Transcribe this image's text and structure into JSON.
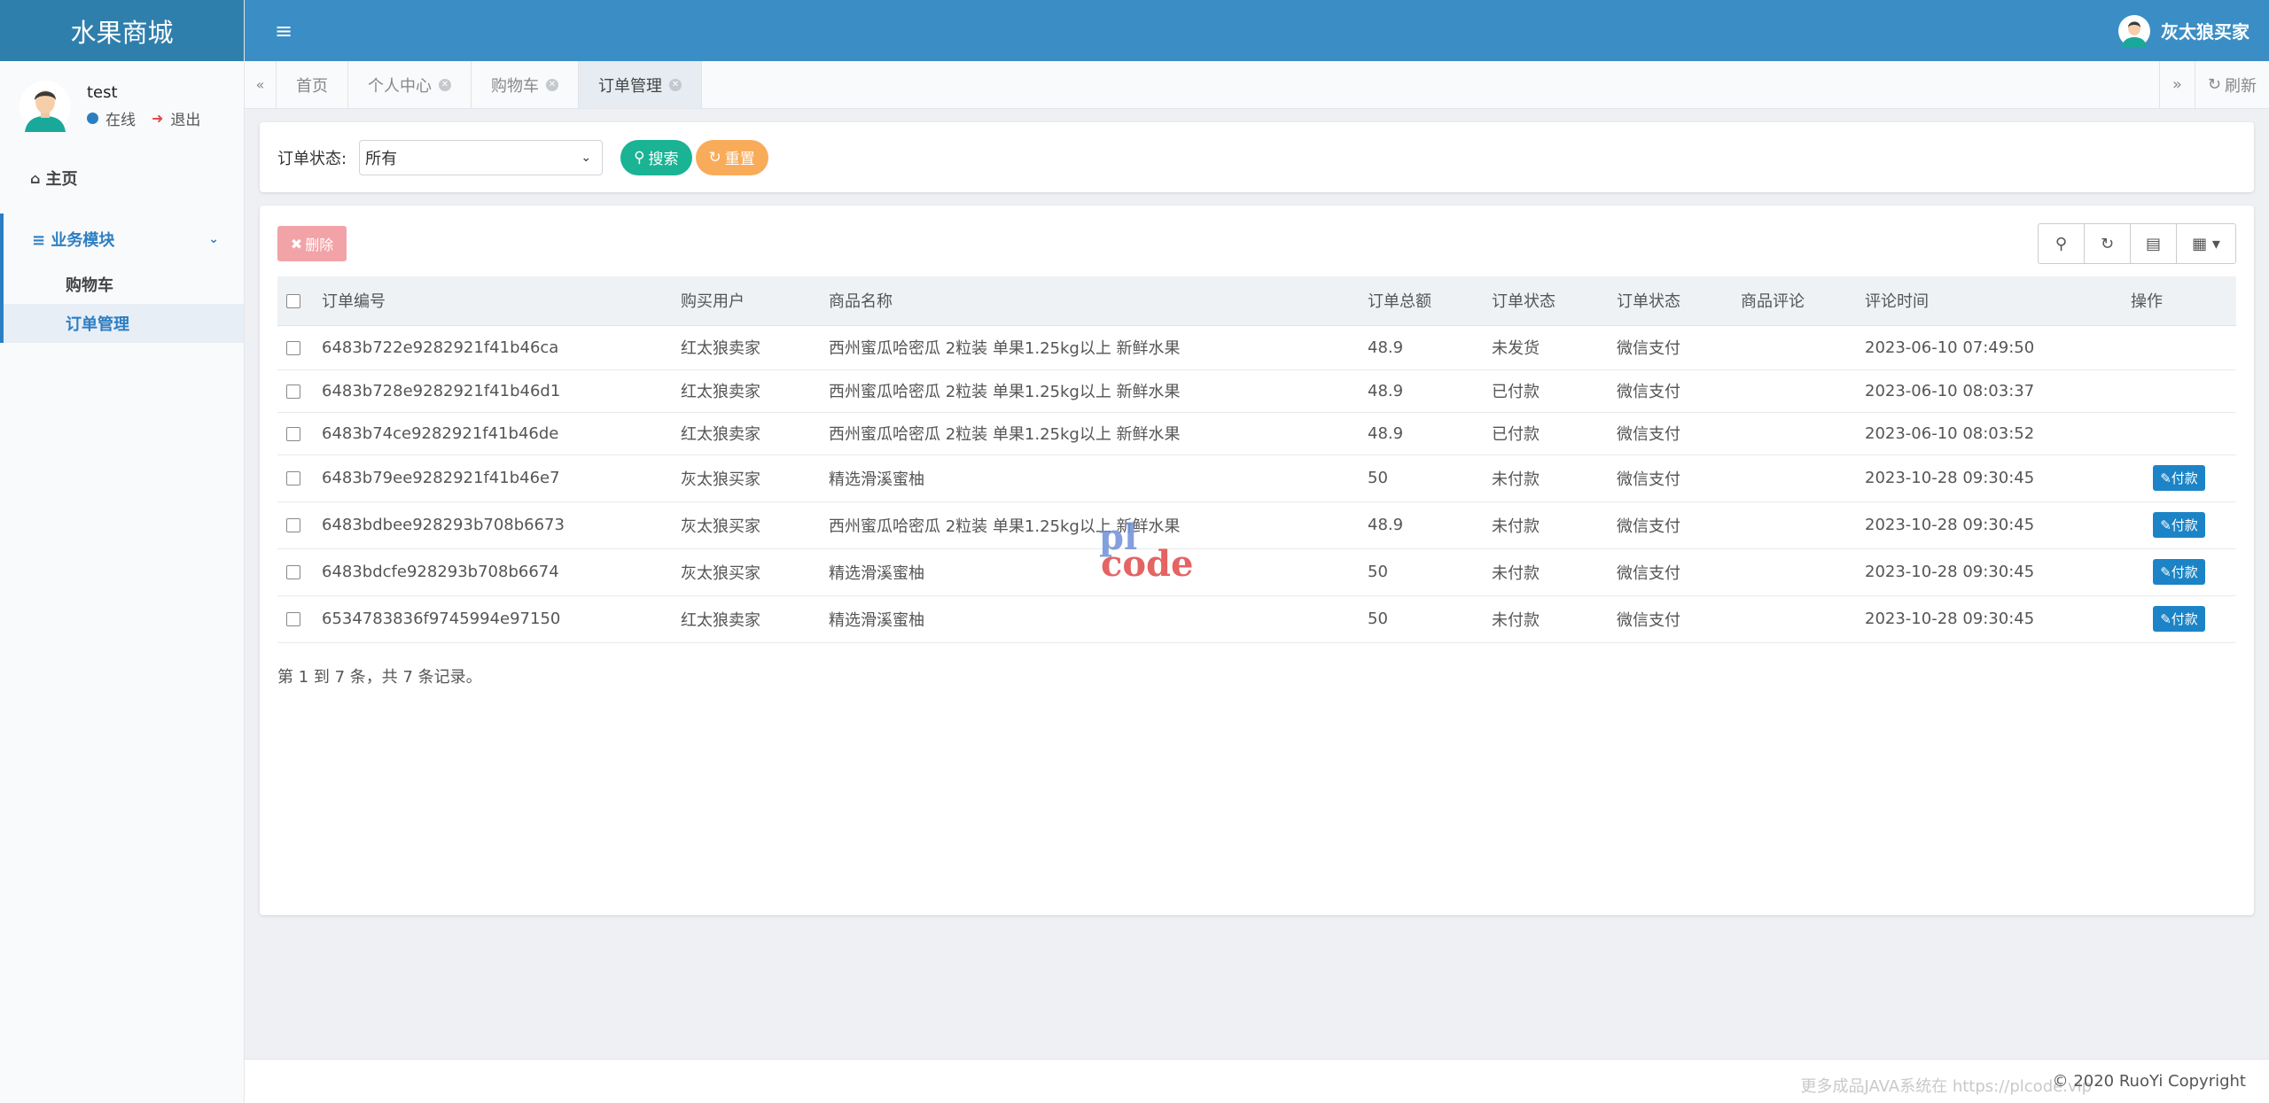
{
  "brand": "水果商城",
  "sidebar": {
    "user": {
      "name": "test",
      "status": "在线",
      "logout": "退出"
    },
    "home": "主页",
    "group": "业务模块",
    "items": [
      {
        "label": "购物车"
      },
      {
        "label": "订单管理"
      }
    ]
  },
  "topbar": {
    "username": "灰太狼买家"
  },
  "tabs": [
    {
      "label": "首页"
    },
    {
      "label": "个人中心"
    },
    {
      "label": "购物车"
    },
    {
      "label": "订单管理"
    }
  ],
  "tabs_right": {
    "refresh": "刷新"
  },
  "search": {
    "label": "订单状态:",
    "selected": "所有",
    "search_btn": "搜索",
    "reset_btn": "重置"
  },
  "toolbar": {
    "delete": "删除"
  },
  "table": {
    "headers": [
      "订单编号",
      "购买用户",
      "商品名称",
      "订单总额",
      "订单状态",
      "订单状态",
      "商品评论",
      "评论时间",
      "操作"
    ],
    "rows": [
      {
        "id": "6483b722e9282921f41b46ca",
        "user": "红太狼卖家",
        "product": "西州蜜瓜哈密瓜 2粒装 单果1.25kg以上 新鲜水果",
        "total": "48.9",
        "status": "未发货",
        "pay": "微信支付",
        "comment": "",
        "time": "2023-06-10 07:49:50",
        "action": ""
      },
      {
        "id": "6483b728e9282921f41b46d1",
        "user": "红太狼卖家",
        "product": "西州蜜瓜哈密瓜 2粒装 单果1.25kg以上 新鲜水果",
        "total": "48.9",
        "status": "已付款",
        "pay": "微信支付",
        "comment": "",
        "time": "2023-06-10 08:03:37",
        "action": ""
      },
      {
        "id": "6483b74ce9282921f41b46de",
        "user": "红太狼卖家",
        "product": "西州蜜瓜哈密瓜 2粒装 单果1.25kg以上 新鲜水果",
        "total": "48.9",
        "status": "已付款",
        "pay": "微信支付",
        "comment": "",
        "time": "2023-06-10 08:03:52",
        "action": ""
      },
      {
        "id": "6483b79ee9282921f41b46e7",
        "user": "灰太狼买家",
        "product": "精选滑溪蜜柚",
        "total": "50",
        "status": "未付款",
        "pay": "微信支付",
        "comment": "",
        "time": "2023-10-28 09:30:45",
        "action": "付款"
      },
      {
        "id": "6483bdbee928293b708b6673",
        "user": "灰太狼买家",
        "product": "西州蜜瓜哈密瓜 2粒装 单果1.25kg以上 新鲜水果",
        "total": "48.9",
        "status": "未付款",
        "pay": "微信支付",
        "comment": "",
        "time": "2023-10-28 09:30:45",
        "action": "付款"
      },
      {
        "id": "6483bdcfe928293b708b6674",
        "user": "灰太狼买家",
        "product": "精选滑溪蜜柚",
        "total": "50",
        "status": "未付款",
        "pay": "微信支付",
        "comment": "",
        "time": "2023-10-28 09:30:45",
        "action": "付款"
      },
      {
        "id": "6534783836f9745994e97150",
        "user": "红太狼卖家",
        "product": "精选滑溪蜜柚",
        "total": "50",
        "status": "未付款",
        "pay": "微信支付",
        "comment": "",
        "time": "2023-10-28 09:30:45",
        "action": "付款"
      }
    ]
  },
  "pagination": "第 1 到 7 条，共 7 条记录。",
  "watermark": {
    "line1": "pl",
    "line2": "code"
  },
  "footer": {
    "copyright": "© 2020 RuoYi Copyright",
    "more": "更多成品JAVA系统在 https://plcode.vip"
  }
}
